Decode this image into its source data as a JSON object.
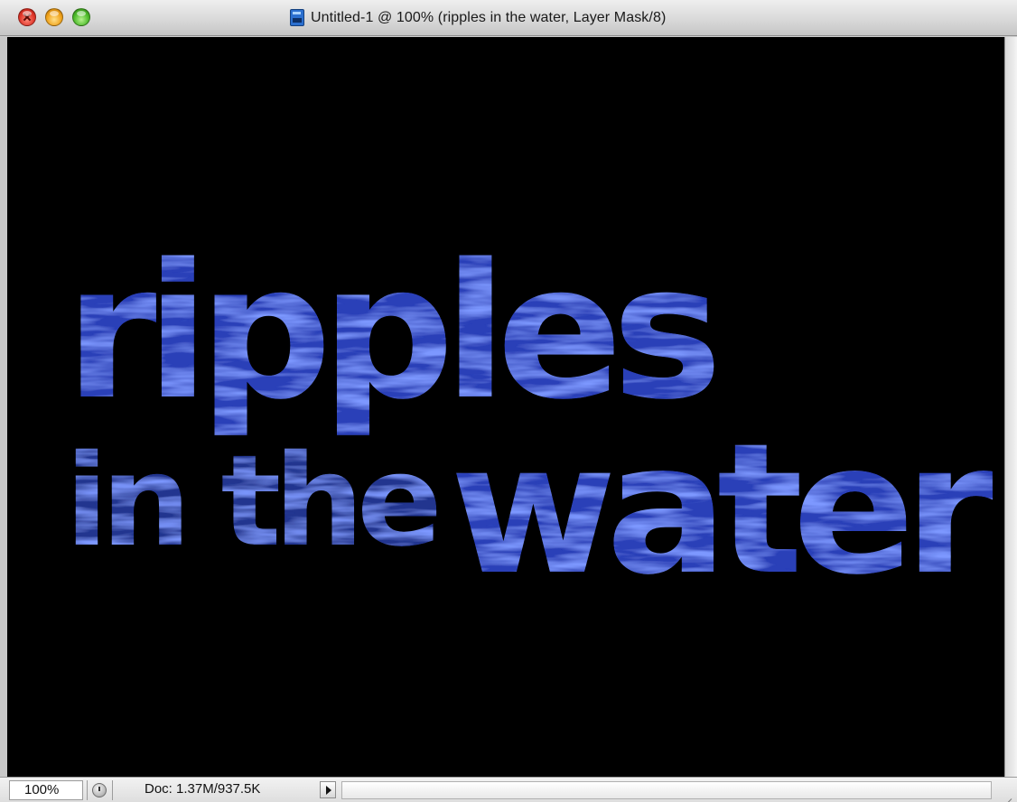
{
  "window": {
    "title": "Untitled-1 @ 100% (ripples in the water, Layer Mask/8)"
  },
  "canvas": {
    "text_line_1": "ripples",
    "text_line_2_part_1": "in the",
    "text_line_2_part_2": "water",
    "background_color": "#000000",
    "text_color": "#3047c8"
  },
  "statusbar": {
    "zoom": "100%",
    "doc_info": "Doc: 1.37M/937.5K"
  },
  "icons": {
    "close": "close-icon",
    "minimize": "minimize-icon",
    "zoom": "zoom-icon",
    "document": "photoshop-document-icon",
    "status_menu": "triangle-right-icon",
    "clock": "clock-icon"
  }
}
